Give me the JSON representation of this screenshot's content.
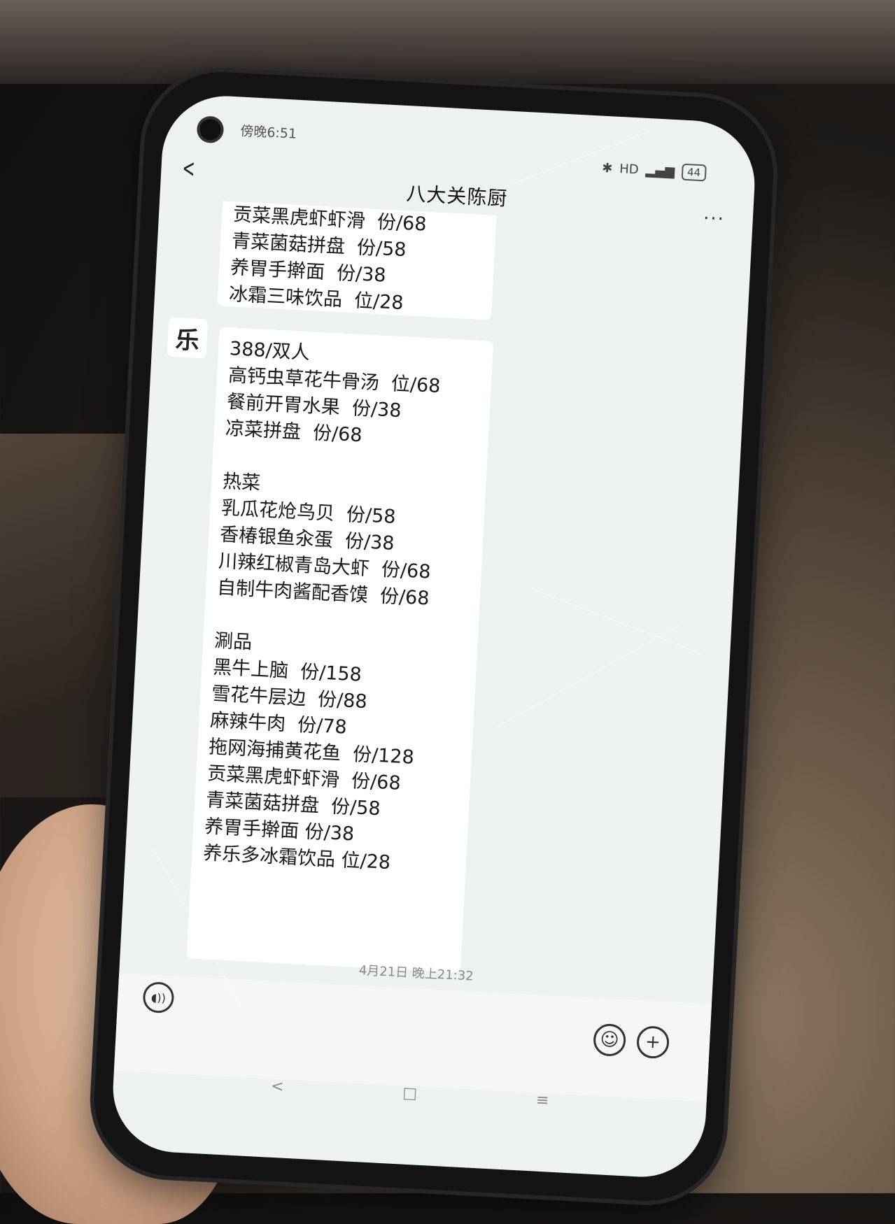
{
  "status_bar": {
    "time": "傍晚6:51",
    "cloud_icon": "cloud-icon",
    "bluetooth_icon": "bluetooth-icon",
    "hd_label": "HD",
    "signal_icon": "signal-icon",
    "battery_level": "44"
  },
  "header": {
    "back_icon": "chevron-left-icon",
    "title": "八大关陈厨",
    "more_label": "···"
  },
  "top_bubble": {
    "lines": [
      "贡菜黑虎虾虾滑  份/68",
      "青菜菌菇拼盘  份/58",
      "养胃手擀面  份/38",
      "冰霜三味饮品  位/28"
    ]
  },
  "avatar": {
    "glyph": "乐"
  },
  "main_bubble": {
    "section1": [
      "388/双人",
      "高钙虫草花牛骨汤  位/68",
      "餐前开胃水果  份/38",
      "凉菜拼盘  份/68"
    ],
    "section2": [
      "热菜",
      "乳瓜花炝鸟贝  份/58",
      "香椿银鱼汆蛋  份/38",
      "川辣红椒青岛大虾  份/68",
      "自制牛肉酱配香馍  份/68"
    ],
    "section3": [
      "涮品",
      "黑牛上脑  份/158",
      "雪花牛层边  份/88",
      "麻辣牛肉  份/78",
      "拖网海捕黄花鱼  份/128",
      "贡菜黑虎虾虾滑  份/68",
      "青菜菌菇拼盘  份/58",
      "养胃手擀面 份/38",
      "养乐多冰霜饮品 位/28"
    ]
  },
  "timestamp": "4月21日 晚上21:32",
  "input_bar": {
    "voice_icon": "voice-icon",
    "emoji_icon": "emoji-icon",
    "plus_icon": "plus-icon"
  },
  "nav_bar": {
    "back_icon": "nav-back-icon",
    "home_icon": "nav-home-icon",
    "menu_icon": "nav-menu-icon"
  }
}
